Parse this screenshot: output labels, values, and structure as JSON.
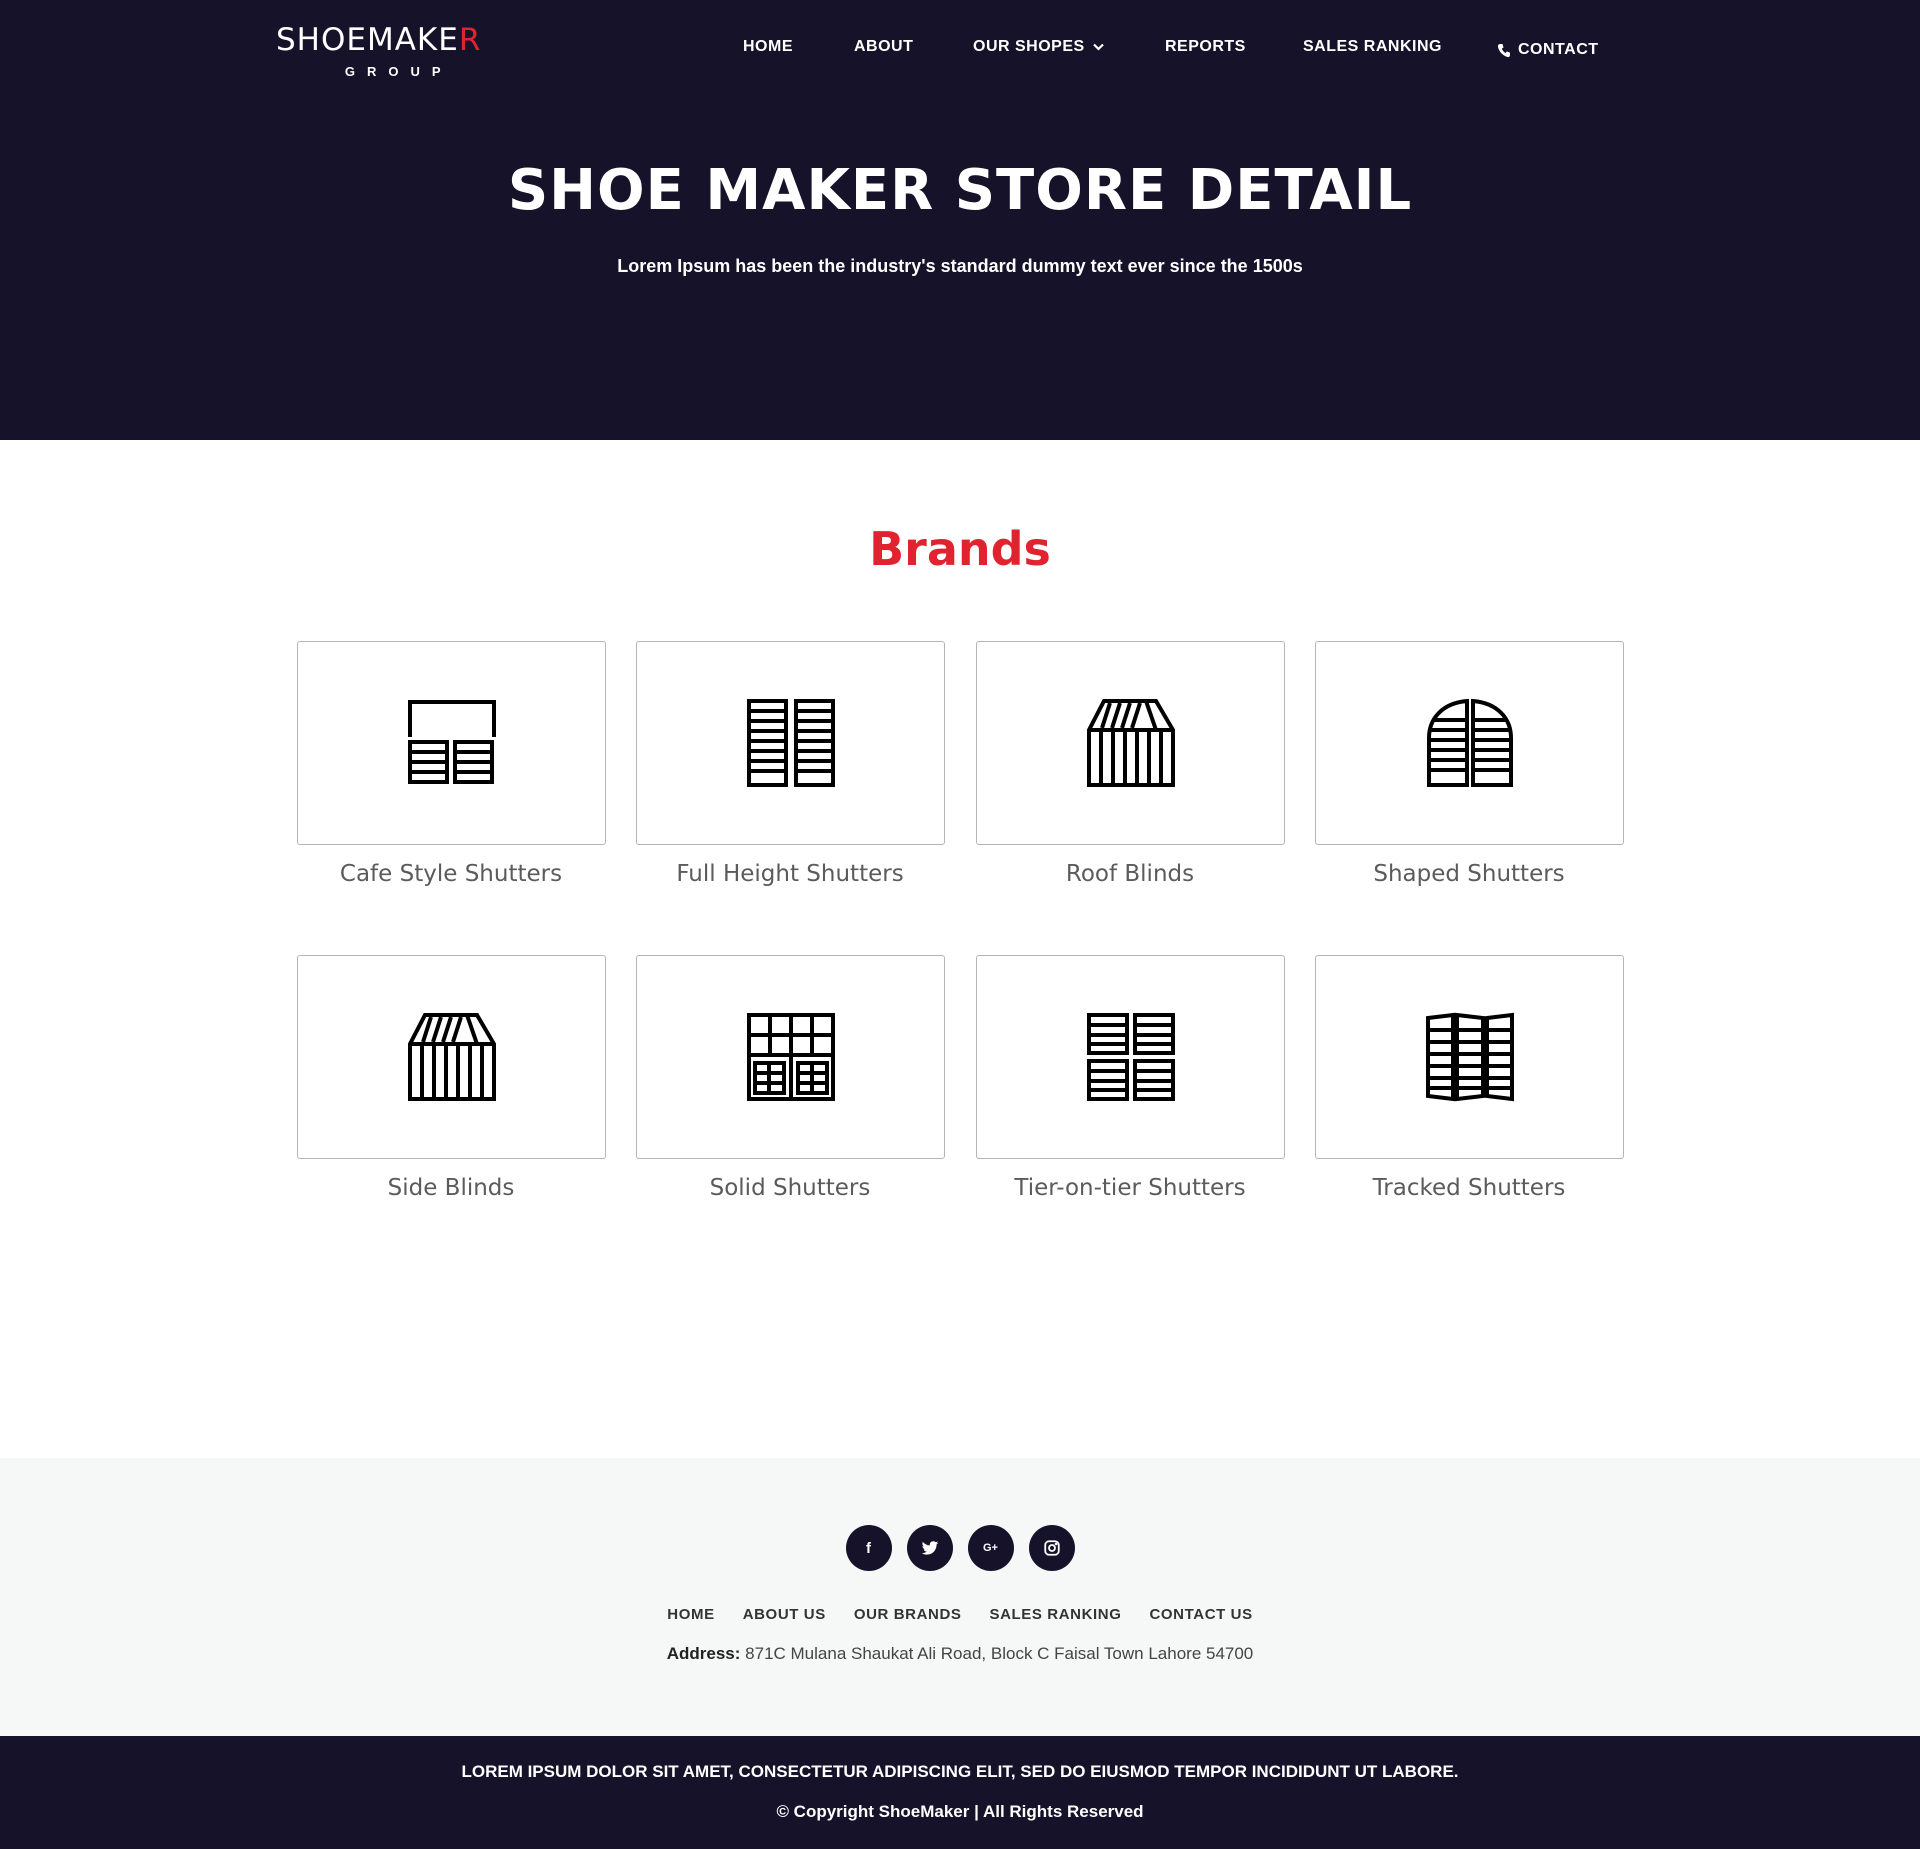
{
  "brand": {
    "logo_main_prefix": "SHOEMAKE",
    "logo_main_accent": "R",
    "logo_sub": "GROUP"
  },
  "nav": {
    "home": "HOME",
    "about": "ABOUT",
    "our_shopes": "OUR SHOPES",
    "reports": "REPORTS",
    "sales_ranking": "SALES RANKING",
    "contact": "CONTACT"
  },
  "hero": {
    "title": "SHOE MAKER STORE DETAIL",
    "subtitle": "Lorem Ipsum has been the industry's standard dummy text ever since the 1500s"
  },
  "brands": {
    "title": "Brands",
    "items": [
      {
        "label": "Cafe Style Shutters",
        "icon": "cafe-style-shutter-icon"
      },
      {
        "label": "Full Height Shutters",
        "icon": "full-height-shutter-icon"
      },
      {
        "label": "Roof Blinds",
        "icon": "roof-blind-icon"
      },
      {
        "label": "Shaped Shutters",
        "icon": "shaped-shutter-icon"
      },
      {
        "label": "Side Blinds",
        "icon": "side-blind-icon"
      },
      {
        "label": "Solid Shutters",
        "icon": "solid-shutter-icon"
      },
      {
        "label": "Tier-on-tier Shutters",
        "icon": "tier-on-tier-shutter-icon"
      },
      {
        "label": "Tracked Shutters",
        "icon": "tracked-shutter-icon"
      }
    ]
  },
  "footer": {
    "socials": {
      "facebook": "f",
      "google_plus": "G+"
    },
    "links": {
      "home": "HOME",
      "about_us": "ABOUT US",
      "our_brands": "OUR BRANDS",
      "sales_ranking": "SALES RANKING",
      "contact_us": "CONTACT US"
    },
    "address_label": "Address:",
    "address_value": "871C Mulana Shaukat Ali Road, Block C Faisal Town Lahore 54700",
    "bottom_text": "LOREM IPSUM DOLOR SIT AMET, CONSECTETUR ADIPISCING ELIT, SED DO EIUSMOD TEMPOR INCIDIDUNT UT LABORE.",
    "copyright": "© Copyright ShoeMaker | All Rights Reserved"
  },
  "colors": {
    "dark_navy": "#151229",
    "accent_red": "#e0232f",
    "footer_bg": "#f6f7f7"
  }
}
